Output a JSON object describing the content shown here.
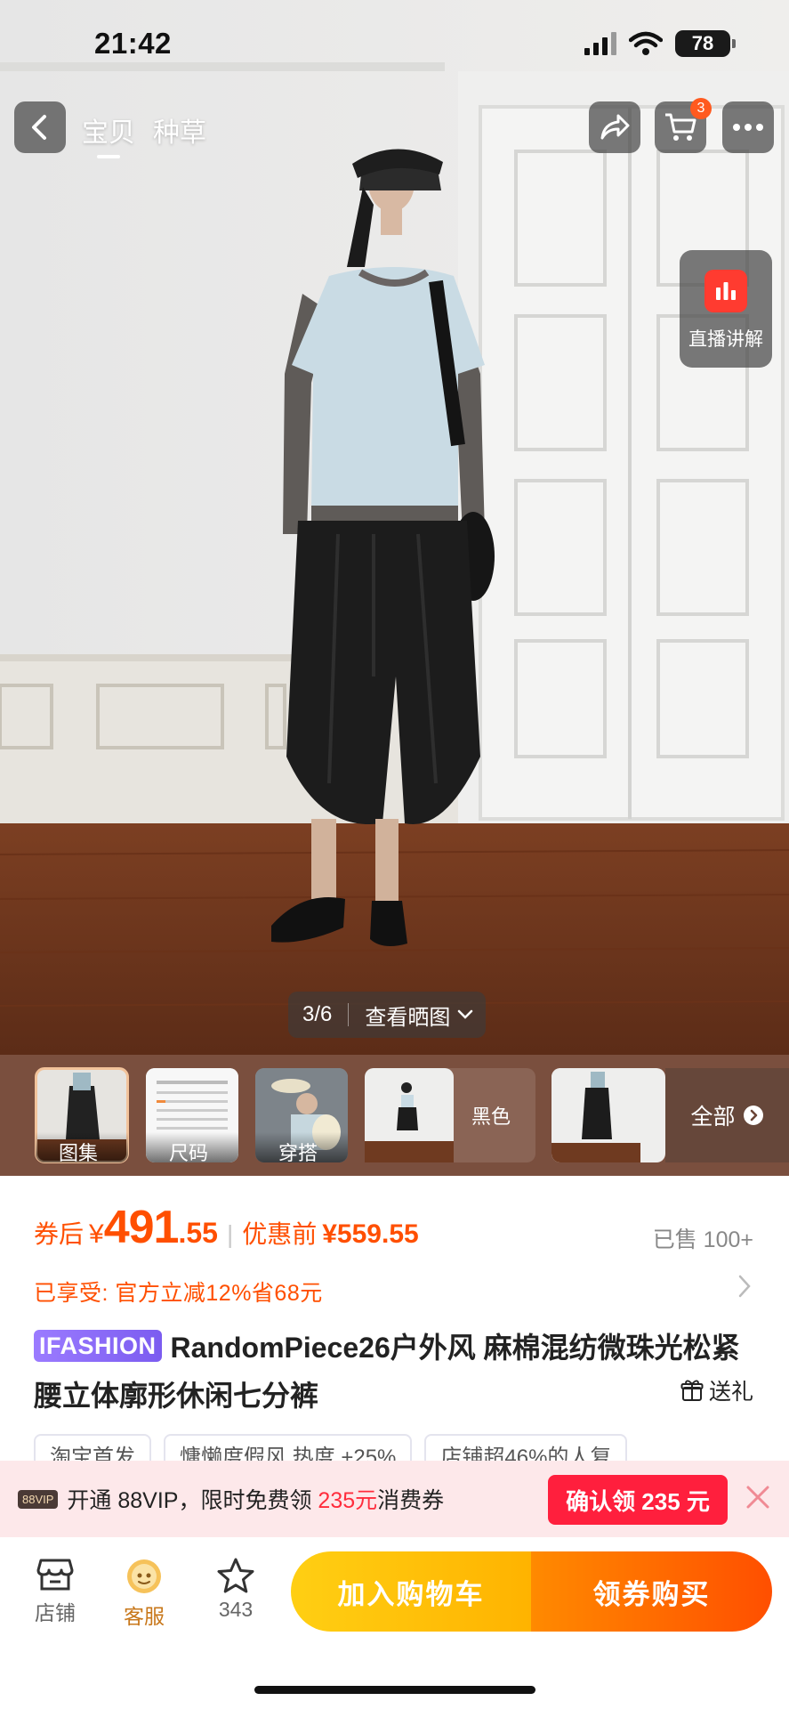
{
  "status_bar": {
    "time": "21:42",
    "battery": "78"
  },
  "top_nav": {
    "tabs": [
      "宝贝",
      "种草"
    ],
    "cart_count": "3"
  },
  "live": {
    "label": "直播讲解"
  },
  "gallery": {
    "counter": "3/6",
    "view_label": "查看晒图"
  },
  "thumbs": {
    "items": [
      "图集",
      "尺码",
      "穿搭"
    ],
    "color_label": "黑色",
    "all_label": "全部"
  },
  "price": {
    "after_coupon_label": "券后",
    "currency": "¥",
    "int": "491",
    "dec": ".55",
    "before_label": "优惠前",
    "before_price": "¥559.55",
    "sold": "已售 100+"
  },
  "promo": {
    "text": "已享受: 官方立减12%省68元"
  },
  "product": {
    "brand": "IFASHION",
    "title": "RandomPiece26户外风 麻棉混纺微珠光松紧腰立体廓形休闲七分裤",
    "gift": "送礼"
  },
  "tags": [
    "淘宝首发",
    "慵懒度假风 热度 +25%",
    "店铺超46%的人复"
  ],
  "vip": {
    "badge": "88VIP",
    "text_prefix": "开通 88VIP，限时免费领 ",
    "amount": "235元",
    "text_suffix": "消费券",
    "button": "确认领 235 元"
  },
  "bottom_bar": {
    "shop": "店铺",
    "service": "客服",
    "fav_count": "343",
    "add_cart": "加入购物车",
    "buy": "领券购买"
  },
  "colors": {
    "accent": "#ff4f00",
    "cart_yellow": "#ffb300",
    "vip_red": "#ff1f3d"
  }
}
